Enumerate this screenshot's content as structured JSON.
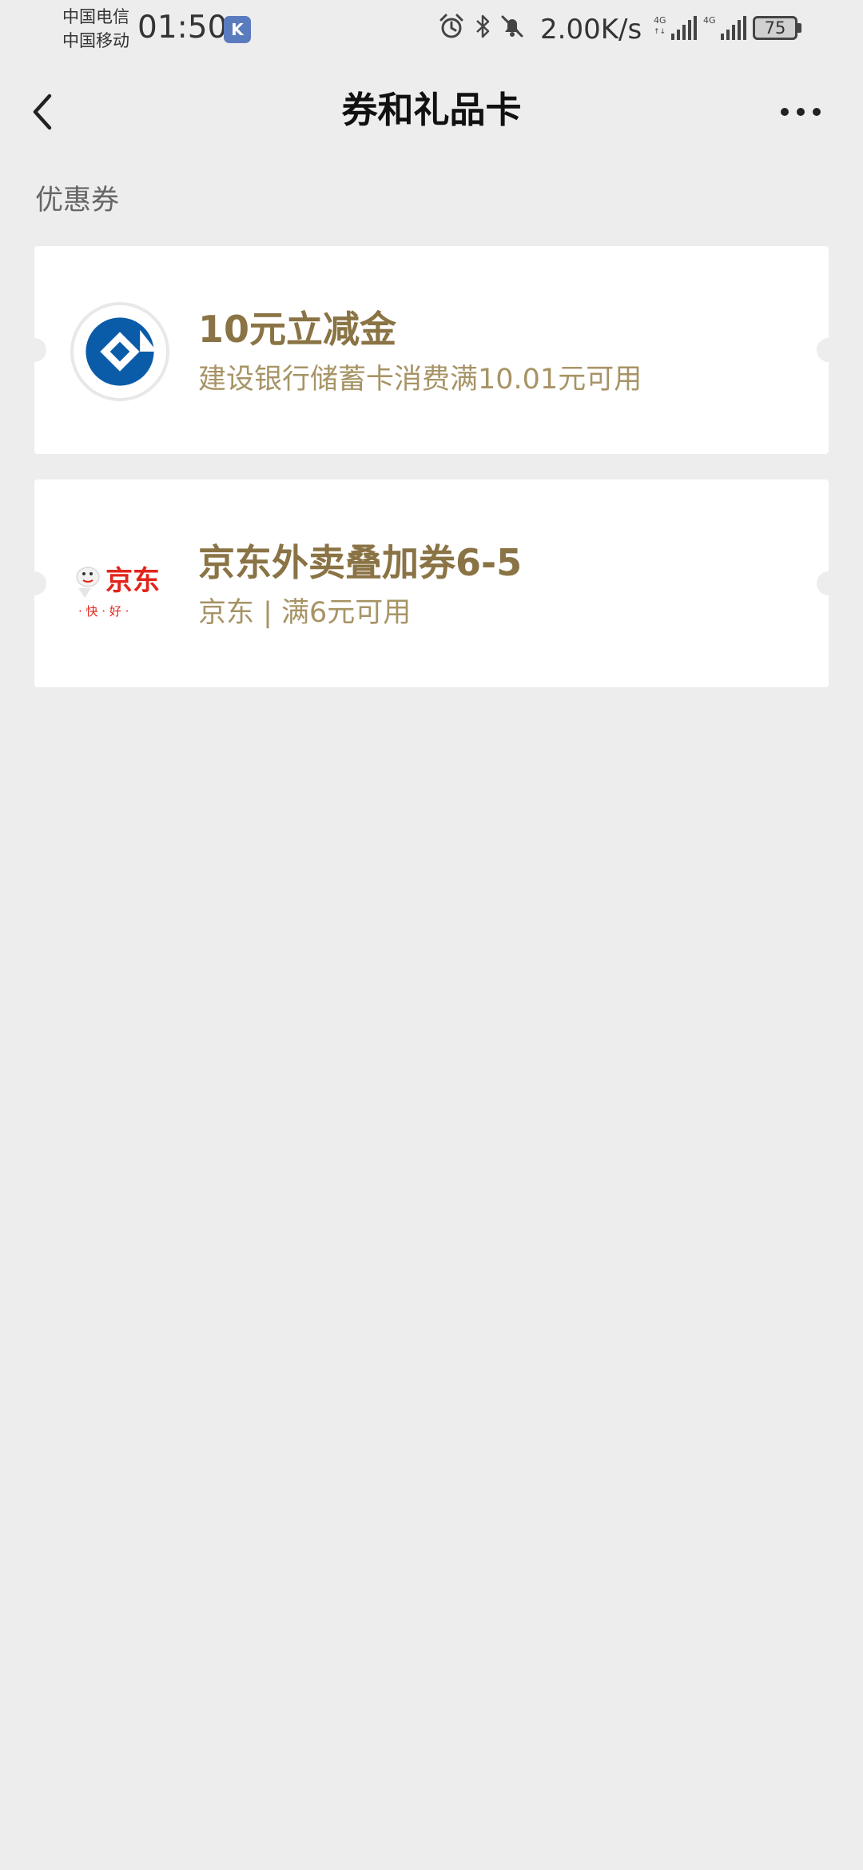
{
  "status_bar": {
    "carrier_1": "中国电信",
    "carrier_2": "中国移动",
    "time": "01:50",
    "app_badge": "K",
    "net_speed": "2.00K/s",
    "signal_1_label": "4G",
    "signal_2_label": "4G",
    "battery": "75"
  },
  "nav": {
    "title": "券和礼品卡"
  },
  "section": {
    "title": "优惠券"
  },
  "coupons": [
    {
      "title": "10元立减金",
      "description": "建设银行储蓄卡消费满10.01元可用",
      "logo": "ccb-logo"
    },
    {
      "title": "京东外卖叠加券6-5",
      "description": "京东 | 满6元可用",
      "logo": "jd-logo",
      "logo_text": "京东",
      "logo_slogan": "· 快 · 好 ·"
    }
  ],
  "colors": {
    "background": "#ededed",
    "card": "#ffffff",
    "coupon_title": "#8a7344",
    "coupon_desc": "#a79466",
    "ccb_blue": "#0b5ca8",
    "jd_red": "#e1251b"
  }
}
